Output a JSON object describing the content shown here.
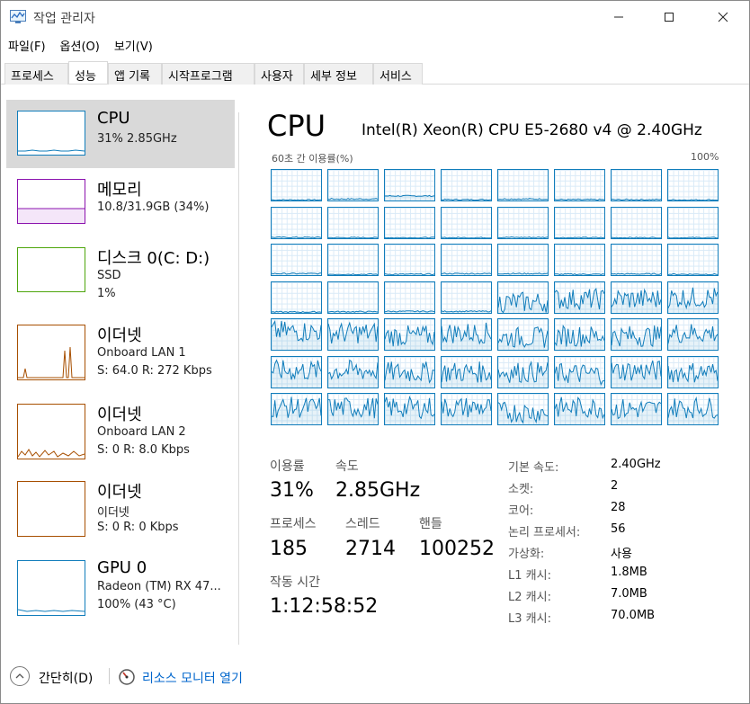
{
  "window": {
    "title": "작업 관리자"
  },
  "menu": [
    "파일(F)",
    "옵션(O)",
    "보기(V)"
  ],
  "tabs": [
    "프로세스",
    "성능",
    "앱 기록",
    "시작프로그램",
    "사용자",
    "세부 정보",
    "서비스"
  ],
  "active_tab": "성능",
  "sidebar": {
    "items": [
      {
        "name": "CPU",
        "line1": "31% 2.85GHz",
        "line2": "",
        "line3": "",
        "color": "#117dbb"
      },
      {
        "name": "메모리",
        "line1": "10.8/31.9GB (34%)",
        "line2": "",
        "line3": "",
        "color": "#8b12ae"
      },
      {
        "name": "디스크 0(C: D:)",
        "line1": "SSD",
        "line2": "1%",
        "line3": "",
        "color": "#4da60c"
      },
      {
        "name": "이더넷",
        "line1": "Onboard LAN 1",
        "line2": "S: 64.0  R: 272 Kbps",
        "line3": "",
        "color": "#a74f01"
      },
      {
        "name": "이더넷",
        "line1": "Onboard LAN 2",
        "line2": "S: 0  R: 8.0 Kbps",
        "line3": "",
        "color": "#a74f01"
      },
      {
        "name": "이더넷",
        "line1": "이더넷",
        "line2": "S: 0  R: 0 Kbps",
        "line3": "",
        "color": "#a74f01"
      },
      {
        "name": "GPU 0",
        "line1": "Radeon (TM) RX 47...",
        "line2": "100%  (43 °C)",
        "line3": "",
        "color": "#117dbb"
      }
    ]
  },
  "main": {
    "title": "CPU",
    "model": "Intel(R) Xeon(R) CPU E5-2680 v4 @ 2.40GHz",
    "axis_left": "60초 간 이용률(%)",
    "axis_right": "100%",
    "stats": {
      "utilization_label": "이용률",
      "utilization": "31%",
      "speed_label": "속도",
      "speed": "2.85GHz",
      "processes_label": "프로세스",
      "processes": "185",
      "threads_label": "스레드",
      "threads": "2714",
      "handles_label": "핸들",
      "handles": "100252",
      "uptime_label": "작동 시간",
      "uptime": "1:12:58:52"
    },
    "info": [
      {
        "label": "기본 속도:",
        "value": "2.40GHz"
      },
      {
        "label": "소켓:",
        "value": "2"
      },
      {
        "label": "코어:",
        "value": "28"
      },
      {
        "label": "논리 프로세서:",
        "value": "56"
      },
      {
        "label": "가상화:",
        "value": "사용"
      },
      {
        "label": "L1 캐시:",
        "value": "1.8MB"
      },
      {
        "label": "L2 캐시:",
        "value": "7.0MB"
      },
      {
        "label": "L3 캐시:",
        "value": "70.0MB"
      }
    ],
    "core_levels": [
      0.02,
      0.05,
      0.15,
      0.03,
      0.05,
      0.03,
      0.03,
      0.02,
      0.03,
      0.02,
      0.02,
      0.02,
      0.03,
      0.02,
      0.02,
      0.02,
      0.05,
      0.03,
      0.03,
      0.05,
      0.05,
      0.03,
      0.04,
      0.03,
      0.03,
      0.04,
      0.05,
      0.05,
      0.35,
      0.45,
      0.45,
      0.5,
      0.6,
      0.55,
      0.45,
      0.55,
      0.4,
      0.45,
      0.45,
      0.55,
      0.55,
      0.55,
      0.5,
      0.5,
      0.5,
      0.45,
      0.55,
      0.5,
      0.55,
      0.55,
      0.55,
      0.55,
      0.4,
      0.55,
      0.5,
      0.55
    ]
  },
  "footer": {
    "collapse_label": "간단히(D)",
    "resource_monitor_label": "리소스 모니터 열기"
  }
}
